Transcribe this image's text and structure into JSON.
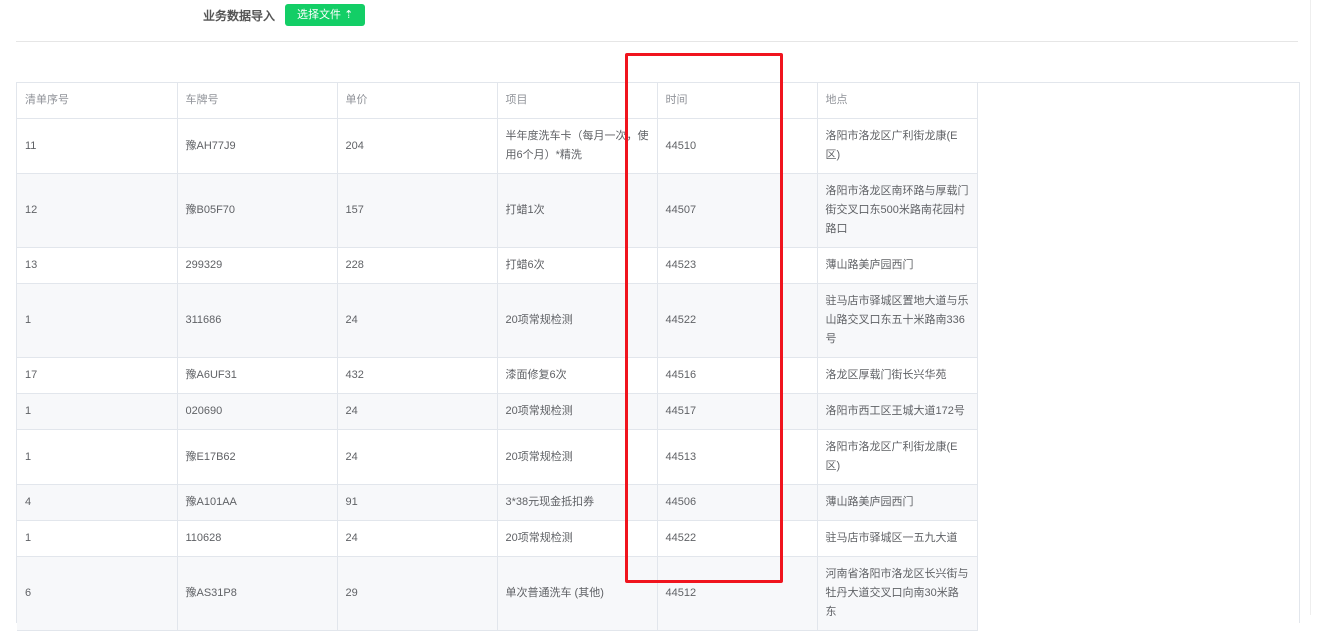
{
  "header": {
    "label": "业务数据导入",
    "button": "选择文件 ⇡"
  },
  "table": {
    "columns": [
      "清单序号",
      "车牌号",
      "单价",
      "项目",
      "时间",
      "地点"
    ],
    "rows": [
      [
        "11",
        "豫AH77J9",
        "204",
        "半年度洗车卡（每月一次，使用6个月）*精洗",
        "44510",
        "洛阳市洛龙区广利街龙康(E区)"
      ],
      [
        "12",
        "豫B05F70",
        "157",
        "打蜡1次",
        "44507",
        "洛阳市洛龙区南环路与厚载门街交叉口东500米路南花园村路口"
      ],
      [
        "13",
        "299329",
        "228",
        "打蜡6次",
        "44523",
        "薄山路美庐园西门"
      ],
      [
        "1",
        "311686",
        "24",
        "20项常规检测",
        "44522",
        "驻马店市驿城区置地大道与乐山路交叉口东五十米路南336号"
      ],
      [
        "17",
        "豫A6UF31",
        "432",
        "漆面修复6次",
        "44516",
        "洛龙区厚载门街长兴华苑"
      ],
      [
        "1",
        "020690",
        "24",
        "20项常规检测",
        "44517",
        "洛阳市西工区王城大道172号"
      ],
      [
        "1",
        "豫E17B62",
        "24",
        "20项常规检测",
        "44513",
        "洛阳市洛龙区广利街龙康(E区)"
      ],
      [
        "4",
        "豫A101AA",
        "91",
        "3*38元现金抵扣券",
        "44506",
        "薄山路美庐园西门"
      ],
      [
        "1",
        "110628",
        "24",
        "20项常规检测",
        "44522",
        "驻马店市驿城区一五九大道"
      ],
      [
        "6",
        "豫AS31P8",
        "29",
        "单次普通洗车 (其他)",
        "44512",
        "河南省洛阳市洛龙区长兴街与牡丹大道交叉口向南30米路东"
      ]
    ]
  }
}
